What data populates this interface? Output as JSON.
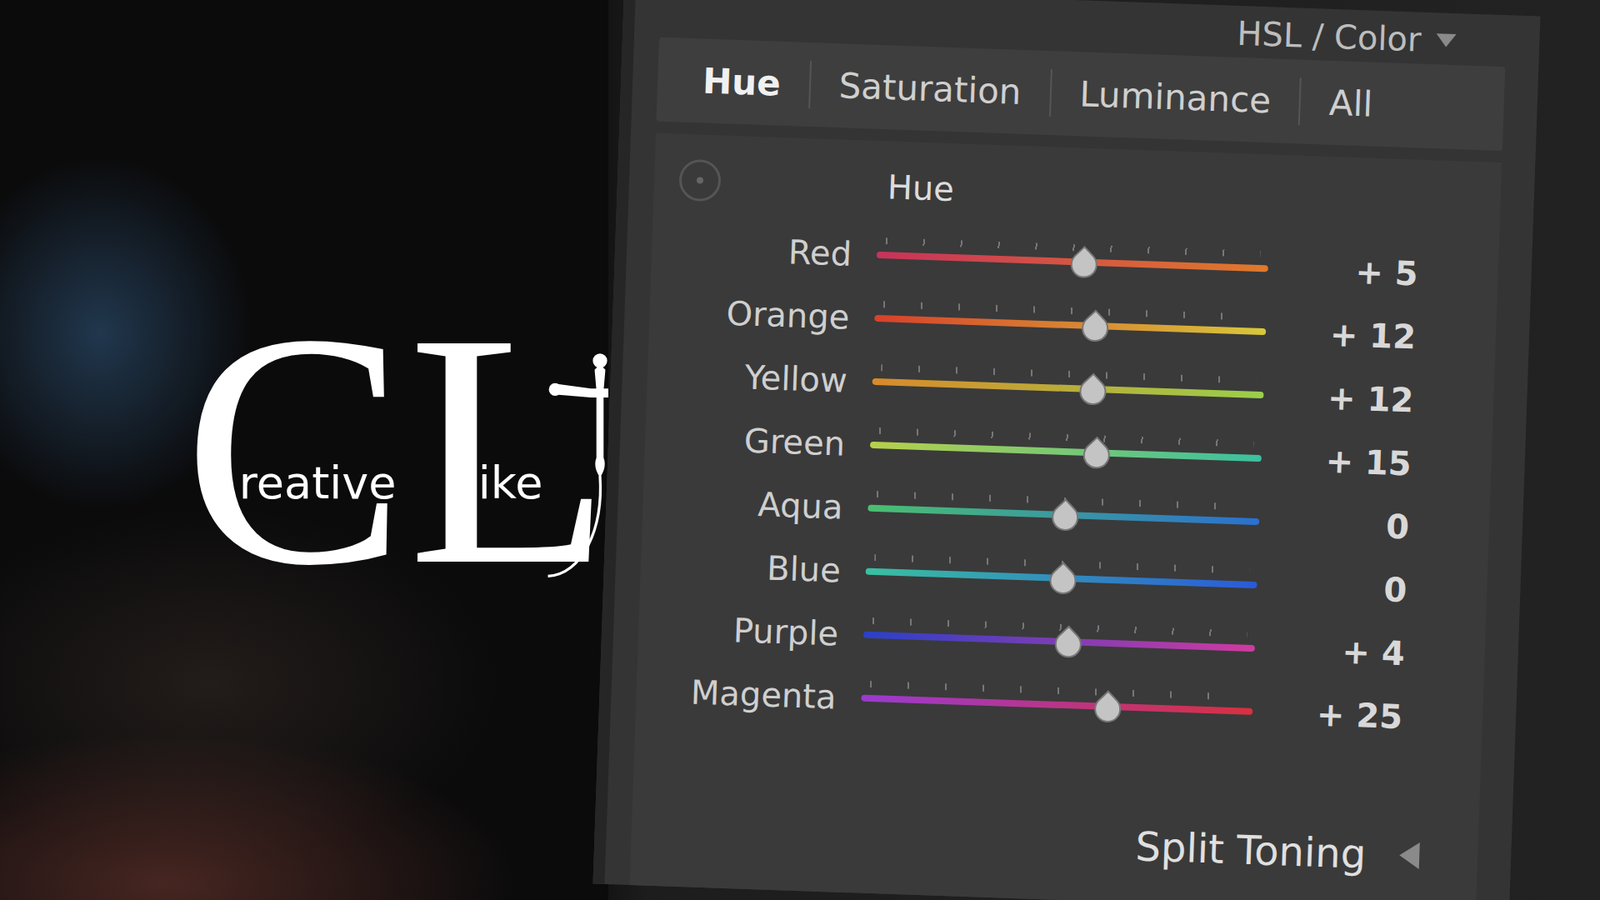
{
  "logo": {
    "words": [
      {
        "initial": "C",
        "rest": "reative"
      },
      {
        "initial": "L",
        "rest": "ike"
      }
    ]
  },
  "panel": {
    "title": "HSL / Color",
    "tabs": [
      {
        "label": "Hue",
        "selected": true
      },
      {
        "label": "Saturation",
        "selected": false
      },
      {
        "label": "Luminance",
        "selected": false
      },
      {
        "label": "All",
        "selected": false
      }
    ],
    "section": "Hue",
    "sliders": [
      {
        "name": "Red",
        "level": 0.525,
        "reading": "+ 5",
        "color": "#c8325a",
        "color_end": "#e07a2a"
      },
      {
        "name": "Orange",
        "level": 0.56,
        "reading": "+ 12",
        "color": "#d8402a",
        "color_end": "#d8c83a"
      },
      {
        "name": "Yellow",
        "level": 0.56,
        "reading": "+ 12",
        "color": "#d88a2a",
        "color_end": "#9ad04a"
      },
      {
        "name": "Green",
        "level": 0.575,
        "reading": "+ 15",
        "color": "#b8d04a",
        "color_end": "#3ac0a0"
      },
      {
        "name": "Aqua",
        "level": 0.5,
        "reading": "0",
        "color": "#4ac070",
        "color_end": "#2a70d0"
      },
      {
        "name": "Blue",
        "level": 0.5,
        "reading": "0",
        "color": "#3ac0a0",
        "color_end": "#2a5ad8"
      },
      {
        "name": "Purple",
        "level": 0.52,
        "reading": "+ 4",
        "color": "#2a40c8",
        "color_end": "#d03aa0"
      },
      {
        "name": "Magenta",
        "level": 0.625,
        "reading": "+ 25",
        "color": "#9a3ad0",
        "color_end": "#d83040"
      }
    ],
    "next_section": "Split Toning"
  }
}
